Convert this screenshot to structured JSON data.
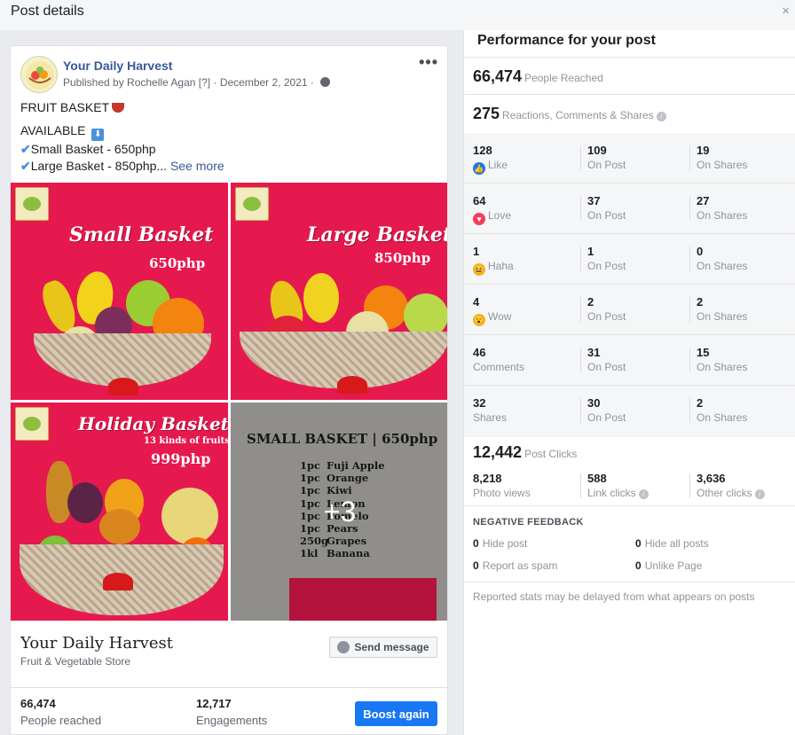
{
  "window": {
    "title": "Post details",
    "close_glyph": "×"
  },
  "post": {
    "page_name": "Your Daily Harvest",
    "published_by": "Published by Rochelle Agan",
    "help_mark": "[?]",
    "date": "December 2, 2021",
    "separator": "·",
    "more_glyph": "•••",
    "text_line1": "FRUIT BASKET",
    "text_line2": "AVAILABLE",
    "text_line3": "Small Basket - 650php",
    "text_line4": "Large Basket - 850php...",
    "see_more": "See more",
    "check_glyph": "✔",
    "down_glyph": "⬇"
  },
  "photos": [
    {
      "title": "Small Basket",
      "price": "650php"
    },
    {
      "title": "Large Basket",
      "price": "850php"
    },
    {
      "title": "Holiday Basket",
      "subtitle": "13 kinds of fruits",
      "price": "999php"
    },
    {
      "menu_title": "SMALL BASKET | 650php",
      "menu": [
        {
          "qty": "1pc",
          "item": "Fuji Apple"
        },
        {
          "qty": "1pc",
          "item": "Orange"
        },
        {
          "qty": "1pc",
          "item": "Kiwi"
        },
        {
          "qty": "1pc",
          "item": "Lemon"
        },
        {
          "qty": "1pc",
          "item": "Pomelo"
        },
        {
          "qty": "1pc",
          "item": "Pears"
        },
        {
          "qty": "250g",
          "item": "Grapes"
        },
        {
          "qty": "1kl",
          "item": "Banana"
        }
      ],
      "more_overlay": "+3"
    }
  ],
  "page_info": {
    "name": "Your Daily Harvest",
    "category": "Fruit & Vegetable Store",
    "send_message": "Send message"
  },
  "card_stats": {
    "reached_value": "66,474",
    "reached_label": "People reached",
    "engagements_value": "12,717",
    "engagements_label": "Engagements",
    "boost_label": "Boost again"
  },
  "performance": {
    "title": "Performance for your post",
    "reach_value": "66,474",
    "reach_label": "People Reached",
    "rcs_value": "275",
    "rcs_label": "Reactions, Comments & Shares",
    "rows": [
      {
        "icon": "like-icon",
        "icon_color": "#1877f2",
        "total": "128",
        "label": "Like",
        "on_post": "109",
        "on_shares": "19"
      },
      {
        "icon": "love-icon",
        "icon_color": "#f33e58",
        "total": "64",
        "label": "Love",
        "on_post": "37",
        "on_shares": "27"
      },
      {
        "icon": "haha-icon",
        "icon_color": "#f7b125",
        "total": "1",
        "label": "Haha",
        "on_post": "1",
        "on_shares": "0"
      },
      {
        "icon": "wow-icon",
        "icon_color": "#f7b125",
        "total": "4",
        "label": "Wow",
        "on_post": "2",
        "on_shares": "2"
      },
      {
        "icon": "",
        "total": "46",
        "label": "Comments",
        "on_post": "31",
        "on_shares": "15"
      },
      {
        "icon": "",
        "total": "32",
        "label": "Shares",
        "on_post": "30",
        "on_shares": "2"
      }
    ],
    "on_post_label": "On Post",
    "on_shares_label": "On Shares",
    "clicks_value": "12,442",
    "clicks_label": "Post Clicks",
    "photo_views_value": "8,218",
    "photo_views_label": "Photo views",
    "link_clicks_value": "588",
    "link_clicks_label": "Link clicks",
    "other_clicks_value": "3,636",
    "other_clicks_label": "Other clicks",
    "info_glyph": "i",
    "negative_title": "NEGATIVE FEEDBACK",
    "hide_post_value": "0",
    "hide_post_label": "Hide post",
    "hide_all_value": "0",
    "hide_all_label": "Hide all posts",
    "spam_value": "0",
    "spam_label": "Report as spam",
    "unlike_value": "0",
    "unlike_label": "Unlike Page",
    "footnote": "Reported stats may be delayed from what appears on posts"
  }
}
